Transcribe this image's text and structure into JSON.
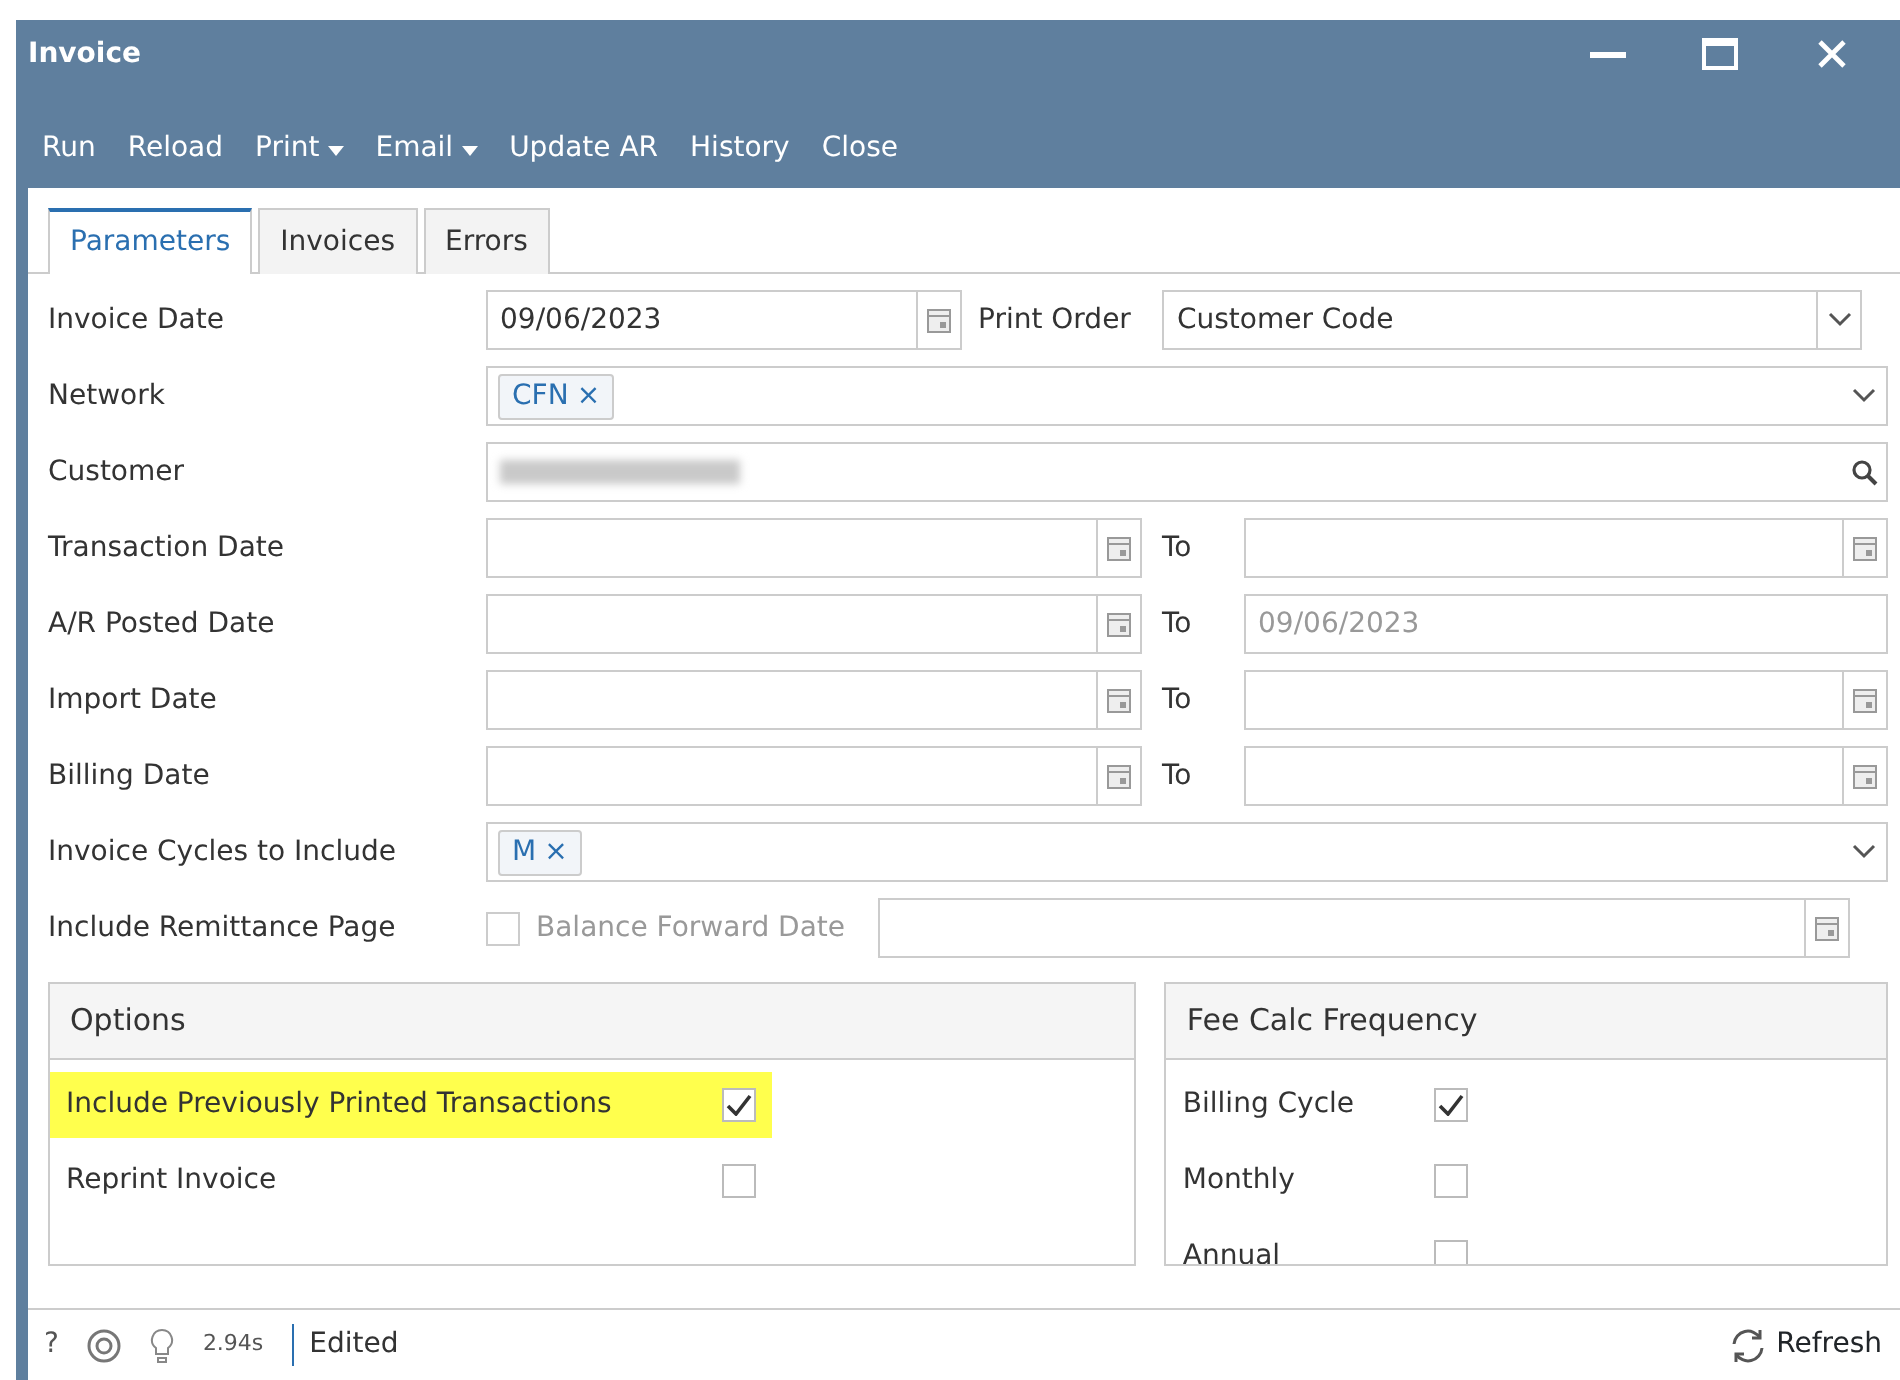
{
  "window": {
    "title": "Invoice"
  },
  "toolbar": [
    {
      "label": "Run",
      "dropdown": false
    },
    {
      "label": "Reload",
      "dropdown": false
    },
    {
      "label": "Print",
      "dropdown": true
    },
    {
      "label": "Email",
      "dropdown": true
    },
    {
      "label": "Update AR",
      "dropdown": false
    },
    {
      "label": "History",
      "dropdown": false
    },
    {
      "label": "Close",
      "dropdown": false
    }
  ],
  "tabs": [
    {
      "label": "Parameters",
      "selected": true
    },
    {
      "label": "Invoices",
      "selected": false
    },
    {
      "label": "Errors",
      "selected": false
    }
  ],
  "rows": [
    {
      "kind": "date_select",
      "label": "Invoice Date",
      "value": "09/06/2023",
      "second_label": "Print Order",
      "select_value": "Customer Code"
    },
    {
      "kind": "tags",
      "label": "Network",
      "tags": [
        {
          "label": "CFN",
          "remove": "×"
        }
      ]
    },
    {
      "kind": "lookup",
      "label": "Customer"
    },
    {
      "kind": "range",
      "label": "Transaction Date",
      "to_label": "To",
      "from_value": "",
      "to_value": "",
      "to_disabled": false
    },
    {
      "kind": "range",
      "label": "A/R Posted Date",
      "to_label": "To",
      "from_value": "",
      "to_value": "09/06/2023",
      "to_disabled": true
    },
    {
      "kind": "range",
      "label": "Import Date",
      "to_label": "To",
      "from_value": "",
      "to_value": "",
      "to_disabled": false
    },
    {
      "kind": "range",
      "label": "Billing Date",
      "to_label": "To",
      "from_value": "",
      "to_value": "",
      "to_disabled": false
    },
    {
      "kind": "tags",
      "label": "Invoice Cycles to Include",
      "tags": [
        {
          "label": "M",
          "remove": "×"
        }
      ]
    },
    {
      "kind": "check_date",
      "label": "Include Remittance Page",
      "checked": false,
      "check_label": "Balance Forward Date",
      "disabled": true
    }
  ],
  "options": {
    "title": "Options",
    "items": [
      {
        "label": "Include Previously Printed Transactions",
        "checked": true,
        "highlighted": true
      },
      {
        "label": "Reprint Invoice",
        "checked": false,
        "highlighted": false
      }
    ]
  },
  "fee_calc": {
    "title": "Fee Calc Frequency",
    "items": [
      {
        "label": "Billing Cycle",
        "checked": true
      },
      {
        "label": "Monthly",
        "checked": false
      },
      {
        "label": "Annual",
        "checked": false
      }
    ]
  },
  "status_bar": {
    "help": "?",
    "elapsed": "2.94s",
    "status": "Edited",
    "refresh": "Refresh"
  }
}
